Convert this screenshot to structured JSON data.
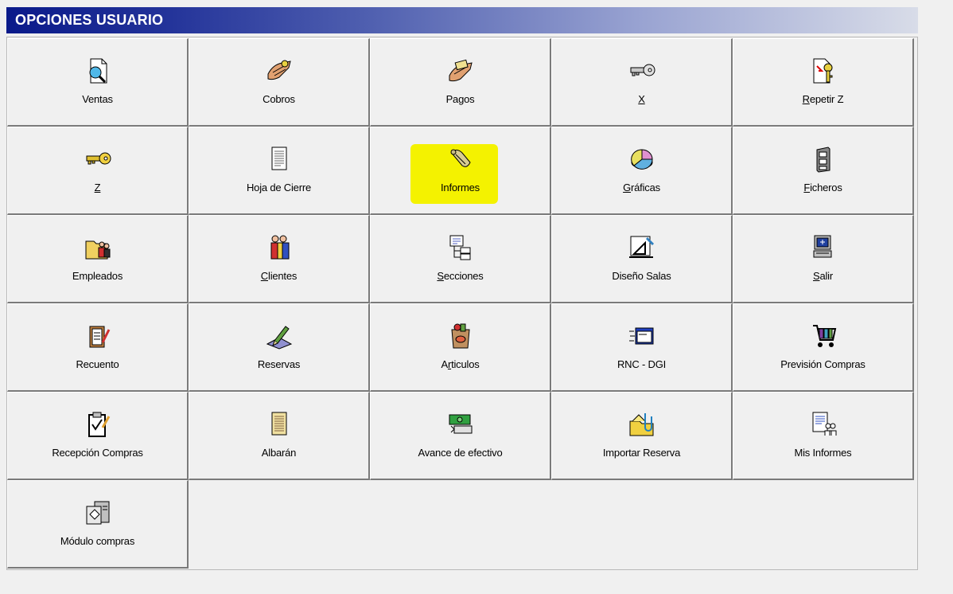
{
  "title": "OPCIONES USUARIO",
  "buttons": [
    {
      "label": "Ventas",
      "icon": "document-magnifier-icon"
    },
    {
      "label": "Cobros",
      "icon": "hand-coin-icon"
    },
    {
      "label": "Pagos",
      "icon": "hand-bills-icon"
    },
    {
      "label": "X",
      "icon": "key-icon"
    },
    {
      "label": "Repetir Z",
      "icon": "document-key-icon"
    },
    {
      "label": "Z",
      "icon": "key-icon"
    },
    {
      "label": "Hoja de Cierre",
      "icon": "sheet-icon"
    },
    {
      "label": "Informes",
      "icon": "scroll-icon"
    },
    {
      "label": "Gráficas",
      "icon": "pie-chart-icon"
    },
    {
      "label": "Ficheros",
      "icon": "file-cabinet-icon"
    },
    {
      "label": "Empleados",
      "icon": "folder-people-icon"
    },
    {
      "label": "Clientes",
      "icon": "people-icon"
    },
    {
      "label": "Secciones",
      "icon": "tree-structure-icon"
    },
    {
      "label": "Diseño Salas",
      "icon": "drafting-icon"
    },
    {
      "label": "Salir",
      "icon": "computer-exit-icon"
    },
    {
      "label": "Recuento",
      "icon": "clipboard-pen-icon"
    },
    {
      "label": "Reservas",
      "icon": "pen-tool-icon"
    },
    {
      "label": "Articulos",
      "icon": "grocery-bag-icon"
    },
    {
      "label": "RNC - DGI",
      "icon": "window-icon"
    },
    {
      "label": "Previsión Compras",
      "icon": "shopping-cart-icon"
    },
    {
      "label": "Recepción Compras",
      "icon": "clipboard-check-icon"
    },
    {
      "label": "Albarán",
      "icon": "receipt-icon"
    },
    {
      "label": "Avance de efectivo",
      "icon": "money-icon"
    },
    {
      "label": "Importar Reserva",
      "icon": "folder-clip-icon"
    },
    {
      "label": "Mis Informes",
      "icon": "report-people-icon"
    },
    {
      "label": "Módulo compras",
      "icon": "module-icon"
    }
  ],
  "colors": {
    "highlight": "#f4f200",
    "title_start": "#0a1a8a"
  }
}
